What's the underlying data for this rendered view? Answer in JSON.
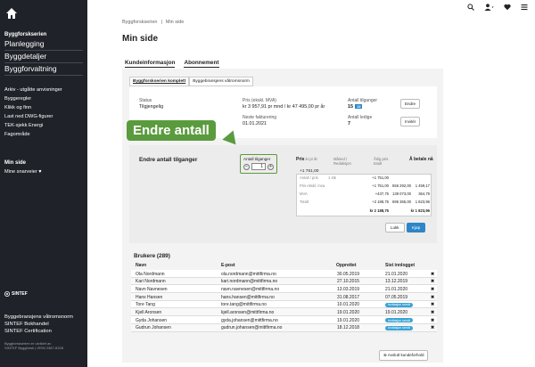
{
  "sidebar": {
    "brand": "Byggforskserien",
    "main_items": [
      "Planlegging",
      "Byggdetaljer",
      "Byggforvaltning"
    ],
    "links": [
      "Arkiv - utgåtte anvisninger",
      "Byggeregler",
      "Klikk og finn",
      "Last ned DWG-figurer",
      "TEK-sjekk Energi",
      "Fagområde"
    ],
    "section": "Min side",
    "favorites": "Mine snarveier ♥",
    "sintef": "SINTEF",
    "footer": [
      "Byggebransjens våtromsnorm",
      "SINTEF Bokhandel",
      "SINTEF Certification"
    ],
    "fine": [
      "Byggforskserien er utviklet av",
      "SINTEF Byggforsk | ISSN 2387-6328"
    ]
  },
  "breadcrumb": [
    "Byggforskserien",
    "Min side"
  ],
  "page_title": "Min side",
  "main_tabs": [
    "Kundeinformasjon",
    "Abonnement"
  ],
  "subtabs": [
    "Byggforskserien komplett",
    "Byggebransjens våtromsnorm"
  ],
  "card": {
    "status_label": "Status",
    "status_value": "Tilgjengelig",
    "price_label": "Pris (ekskl. MVA)",
    "price_value": "kr 3 957,91 pr mnd / kr 47 495,00 pr år",
    "invoice_label": "Neste fakturering",
    "invoice_value": "01.01.2021",
    "access_label": "Antall tilganger",
    "access_value": "15",
    "access_badge": "15",
    "free_label": "Antall ledige",
    "free_value": "7",
    "endre_btn": "Endre",
    "invite_btn": "Invitér"
  },
  "callout": "Endre antall",
  "modal": {
    "title": "Endre antall tilganger",
    "stepper_label": "Antall tilganger",
    "stepper_value": "1",
    "col_pris": "Pris",
    "col_pris_sub": "kr pr år",
    "col_maned": "Måned / Redaksjon",
    "col_arlig": "Årlig pris",
    "col_arlig_sub": "totalt",
    "col_betale": "Å betale nå",
    "top_price": "+1 751,00",
    "rows": [
      {
        "label": "Antall / pris",
        "extra": "1 stk",
        "c1": "+1 751,00",
        "c2": "",
        "c3": ""
      },
      {
        "label": "Pris ekskl. mva",
        "extra": "",
        "c1": "+1 751,00",
        "c2": "556 292,00",
        "c3": "1 459,17"
      },
      {
        "label": "MVA",
        "extra": "",
        "c1": "+437,75",
        "c2": "139 073,00",
        "c3": "364,79"
      },
      {
        "label": "Totalt",
        "extra": "",
        "c1": "+2 188,75",
        "c2": "695 365,00",
        "c3": "1 823,96"
      }
    ],
    "total_a": "kr 2 188,75",
    "total_b": "kr 1 823,96",
    "cancel": "Lukk",
    "confirm": "Kjøp"
  },
  "users": {
    "title": "Brukere (289)",
    "headers": [
      "Navn",
      "E-post",
      "Opprettet",
      "Sist innlogget"
    ],
    "rows": [
      {
        "name": "Ola Nordmann",
        "email": "ola.nordmann@mittfirma.no",
        "created": "30.05.2019",
        "last": "21.01.2020",
        "pill": false
      },
      {
        "name": "Kari Nordmann",
        "email": "kari.nordmann@mittfirma.no",
        "created": "27.10.2015",
        "last": "13.12.2019",
        "pill": false
      },
      {
        "name": "Navn Navnesen",
        "email": "navn.navnesen@mittfirma.no",
        "created": "13.03.2019",
        "last": "21.01.2020",
        "pill": false
      },
      {
        "name": "Hans Hansen",
        "email": "hans.hansen@mittfirma.no",
        "created": "31.08.2017",
        "last": "07.05.2019",
        "pill": false
      },
      {
        "name": "Tore Tang",
        "email": "tore.tang@mittfirma.no",
        "created": "10.01.2020",
        "last": "Invitasjon sendt",
        "pill": true
      },
      {
        "name": "Kjell Aronsen",
        "email": "kjell.aronsen@mittfirma.no",
        "created": "19.01.2020",
        "last": "19.01.2020",
        "pill": false
      },
      {
        "name": "Gyda Johansen",
        "email": "gyda.johansen@mittfirma.no",
        "created": "19.01.2020",
        "last": "Invitasjon sendt",
        "pill": true
      },
      {
        "name": "Gudrun Johansen",
        "email": "gudrun.johansen@mittfirma.no",
        "created": "18.12.2018",
        "last": "Invitasjon sendt",
        "pill": true
      }
    ],
    "remove_glyph": "✖"
  },
  "avslutt": "Avslutt kundeforhold",
  "colors": {
    "sidebar": "#1f2228",
    "accent_green": "#5a9b3e",
    "button_blue": "#2d86c7"
  },
  "icons": [
    "home-icon",
    "search-icon",
    "user-icon",
    "heart-icon",
    "menu-icon"
  ]
}
